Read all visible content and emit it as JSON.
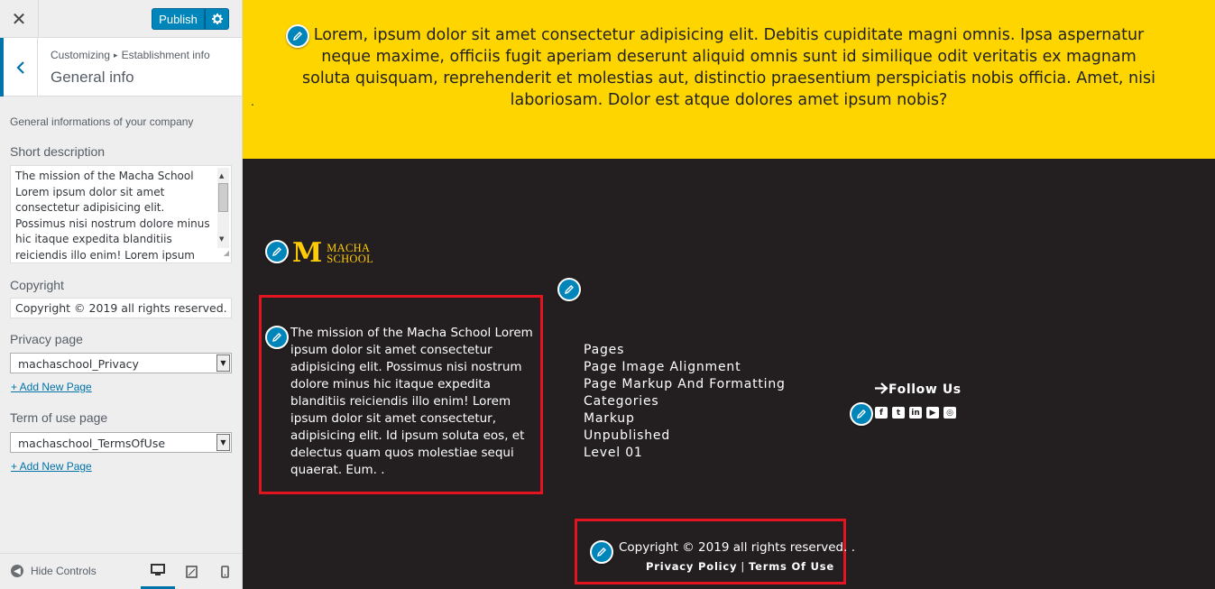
{
  "header": {
    "close_label": "✕",
    "publish_label": "Publish"
  },
  "section": {
    "breadcrumb_root": "Customizing",
    "breadcrumb_parent": "Establishment info",
    "title": "General info"
  },
  "controls": {
    "description": "General informations of your company",
    "short_description": {
      "label": "Short description",
      "value": "The mission of the Macha School Lorem ipsum dolor sit amet consectetur adipisicing elit. Possimus nisi nostrum dolore minus hic itaque expedita blanditiis reiciendis illo enim! Lorem ipsum dolor sit amet consectetur, adipisicing elit. Id ipsum soluta eos, et delectus quam quos molestiae sequi quaerat. Eum."
    },
    "copyright": {
      "label": "Copyright",
      "value": "Copyright © 2019 all rights reserved."
    },
    "privacy_page": {
      "label": "Privacy page",
      "selected": "machaschool_Privacy",
      "add_link": "+ Add New Page"
    },
    "terms_page": {
      "label": "Term of use page",
      "selected": "machaschool_TermsOfUse",
      "add_link": "+ Add New Page"
    }
  },
  "footer_bar": {
    "hide_controls": "Hide Controls"
  },
  "preview": {
    "yellow_text": "Lorem, ipsum dolor sit amet consectetur adipisicing elit. Debitis cupiditate magni omnis. Ipsa aspernatur neque maxime, officiis fugit aperiam deserunt aliquid omnis sunt id similique odit veritatis ex magnam soluta quisquam, reprehenderit et molestias aut, distinctio praesentium perspiciatis nobis officia. Amet, nisi laboriosam. Dolor est atque dolores amet ipsum nobis?",
    "yellow_dot": ".",
    "logo_letter": "M",
    "logo_line1": "MACHA",
    "logo_line2": "SCHOOL",
    "about_text": "The mission of the Macha School Lorem ipsum dolor sit amet consectetur adipisicing elit. Possimus nisi nostrum dolore minus hic itaque expedita blanditiis reiciendis illo enim! Lorem ipsum dolor sit amet consectetur, adipisicing elit. Id ipsum soluta eos, et delectus quam quos molestiae sequi quaerat. Eum. .",
    "menu": [
      "Pages",
      "Page Image Alignment",
      "Page Markup And Formatting",
      "Categories",
      "Markup",
      "Unpublished",
      "Level 01"
    ],
    "follow_label": "Follow Us",
    "socials": [
      "facebook-icon",
      "twitter-icon",
      "linkedin-icon",
      "youtube-icon",
      "instagram-icon"
    ],
    "copyright_text": "Copyright © 2019 all rights reserved. .",
    "privacy_link": "Privacy Policy",
    "separator": "|",
    "terms_link": "Terms Of Use"
  },
  "colors": {
    "accent": "#0085ba",
    "yellow_band": "#ffd500",
    "footer_bg": "#231f20",
    "highlight_border": "#e1141f",
    "logo_gold": "#ffcb05"
  }
}
